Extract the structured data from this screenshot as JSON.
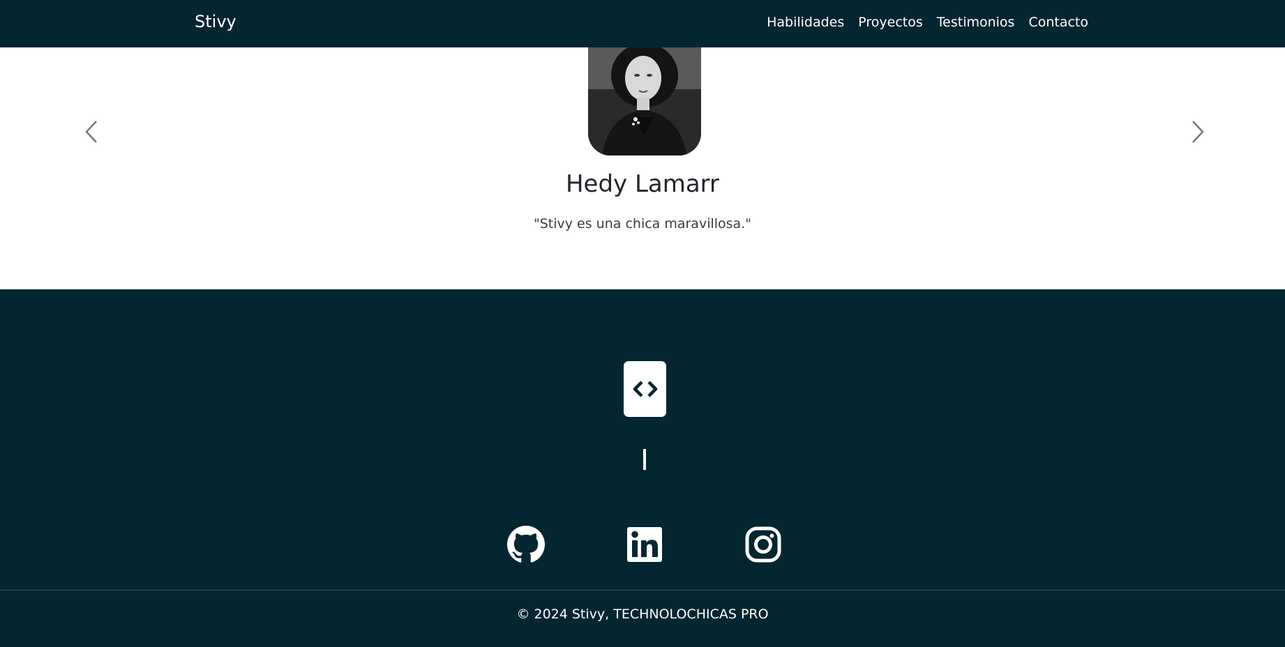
{
  "nav": {
    "brand": "Stivy",
    "links": [
      "Habilidades",
      "Proyectos",
      "Testimonios",
      "Contacto"
    ]
  },
  "testimonial": {
    "name": "Hedy Lamarr",
    "quote": "\"Stivy es una chica maravillosa.\"",
    "photo_icon": "portrait-photo",
    "prev_icon": "chevron-left-icon",
    "next_icon": "chevron-right-icon"
  },
  "footer": {
    "logo_icon": "code-brackets-icon",
    "typing_cursor": "|",
    "social": [
      "github-icon",
      "linkedin-icon",
      "instagram-icon"
    ],
    "copyright": "© 2024 Stivy, TECHNOLOCHICAS PRO"
  },
  "colors": {
    "primary_dark": "#042630",
    "text_dark": "#212529",
    "white": "#ffffff"
  }
}
